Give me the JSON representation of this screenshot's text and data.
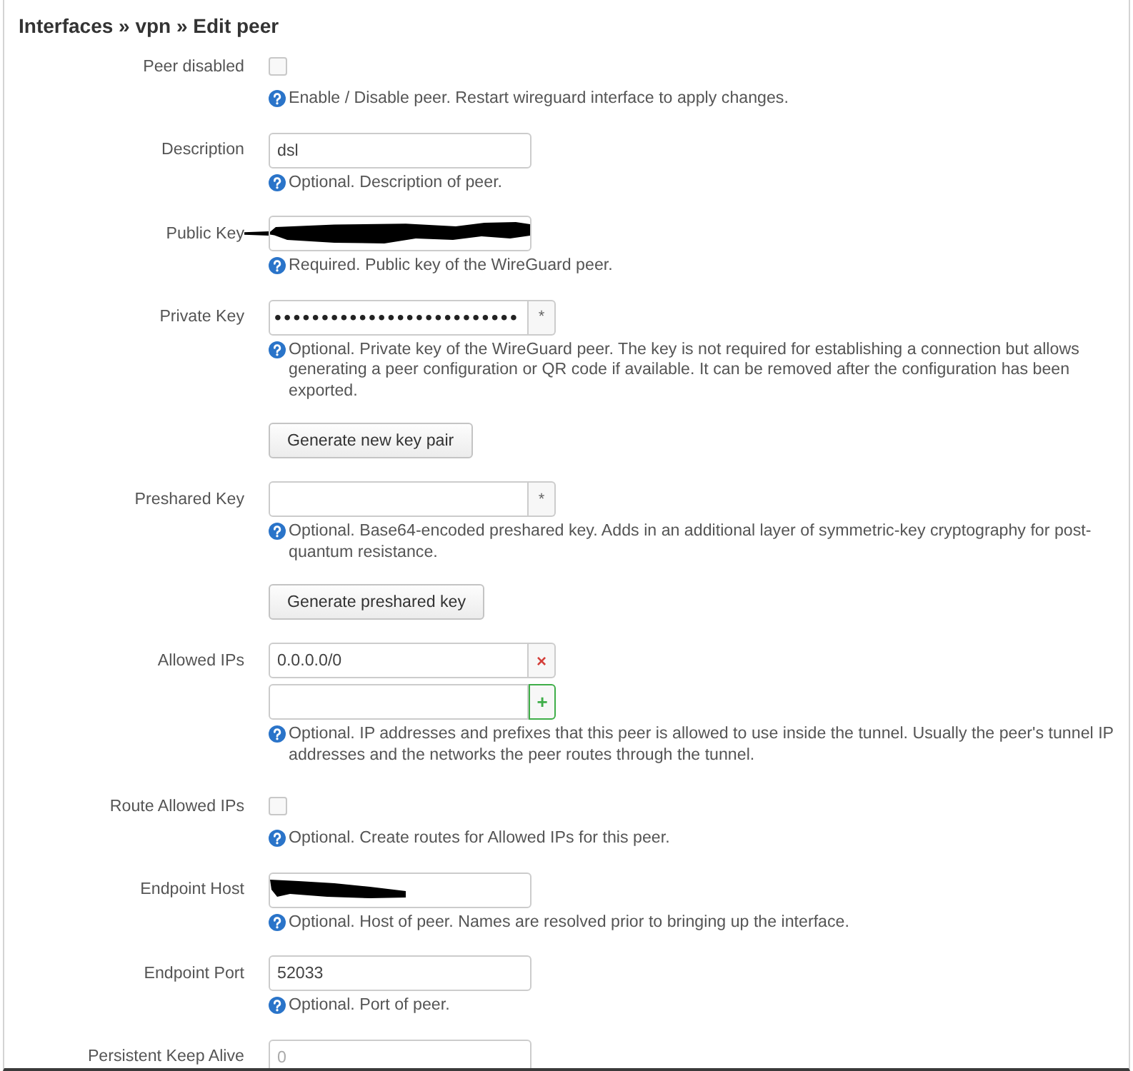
{
  "title": "Interfaces » vpn » Edit peer",
  "fields": [
    {
      "kind": "checkbox",
      "label": "Peer disabled",
      "checked": false,
      "help": "Enable / Disable peer. Restart wireguard interface to apply changes."
    },
    {
      "kind": "text",
      "label": "Description",
      "value": "dsl",
      "redacted": false,
      "help": "Optional. Description of peer."
    },
    {
      "kind": "text",
      "label": "Public Key",
      "redacted": true,
      "help": "Required. Public key of the WireGuard peer."
    },
    {
      "kind": "secret",
      "label": "Private Key",
      "value": "••••••••••••••••••••••••••",
      "toggle": "*",
      "help": "Optional. Private key of the WireGuard peer. The key is not required for establishing a connection but allows generating a peer configuration or QR code if available. It can be removed after the configuration has been exported.",
      "button": "Generate new key pair"
    },
    {
      "kind": "secret",
      "label": "Preshared Key",
      "toggle": "*",
      "help": "Optional. Base64-encoded preshared key. Adds in an additional layer of symmetric-key cryptography for post-quantum resistance.",
      "button": "Generate preshared key"
    },
    {
      "kind": "list",
      "label": "Allowed IPs",
      "entries": [
        {
          "kind": "remove",
          "value": "0.0.0.0/0",
          "action": "×"
        },
        {
          "kind": "add",
          "action": "+"
        }
      ],
      "help": "Optional. IP addresses and prefixes that this peer is allowed to use inside the tunnel. Usually the peer's tunnel IP addresses and the networks the peer routes through the tunnel."
    },
    {
      "kind": "checkbox",
      "label": "Route Allowed IPs",
      "checked": false,
      "help": "Optional. Create routes for Allowed IPs for this peer."
    },
    {
      "kind": "text",
      "label": "Endpoint Host",
      "redacted": true,
      "help": "Optional. Host of peer. Names are resolved prior to bringing up the interface."
    },
    {
      "kind": "text",
      "label": "Endpoint Port",
      "value": "52033",
      "redacted": false,
      "help": "Optional. Port of peer."
    },
    {
      "kind": "text",
      "label": "Persistent Keep Alive",
      "placeholder": "0",
      "redacted": false
    }
  ]
}
